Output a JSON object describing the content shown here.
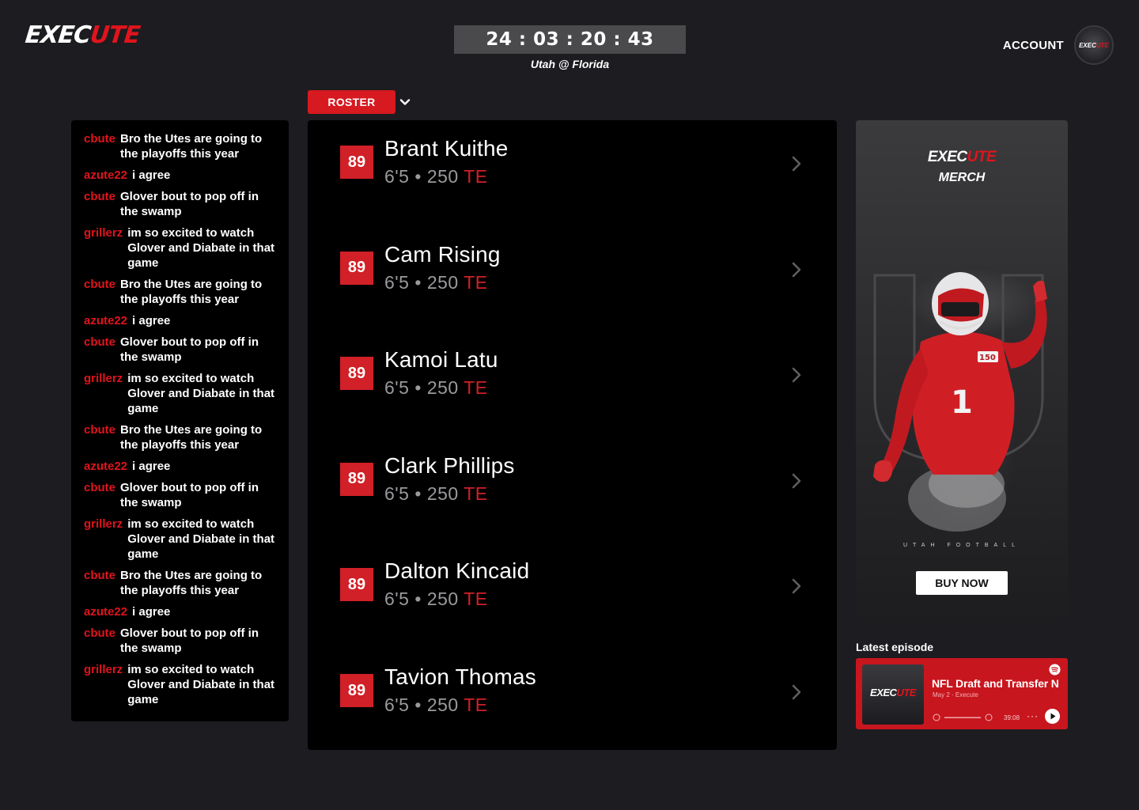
{
  "brand": {
    "logo_white": "EXEC",
    "logo_red": "UTE",
    "accent": "#e0141c"
  },
  "header": {
    "countdown": "24 : 03 : 20 : 43",
    "matchup": "Utah @ Florida",
    "account_label": "ACCOUNT",
    "avatar_logo_white": "EXEC",
    "avatar_logo_red": "UTE"
  },
  "roster_dropdown": {
    "label": "ROSTER"
  },
  "chat": {
    "messages": [
      {
        "user": "cbute",
        "text": "Bro the Utes are going to the playoffs this year"
      },
      {
        "user": "azute22",
        "text": "i agree"
      },
      {
        "user": "cbute",
        "text": "Glover bout to pop off in the swamp"
      },
      {
        "user": "grillerz",
        "text": "im so excited to watch Glover and Diabate in that game"
      },
      {
        "user": "cbute",
        "text": "Bro the Utes are going to the playoffs this year"
      },
      {
        "user": "azute22",
        "text": "i agree"
      },
      {
        "user": "cbute",
        "text": "Glover bout to pop off in the swamp"
      },
      {
        "user": "grillerz",
        "text": "im so excited to watch Glover and Diabate in that game"
      },
      {
        "user": "cbute",
        "text": "Bro the Utes are going to the playoffs this year"
      },
      {
        "user": "azute22",
        "text": "i agree"
      },
      {
        "user": "cbute",
        "text": "Glover bout to pop off in the swamp"
      },
      {
        "user": "grillerz",
        "text": "im so excited to watch Glover and Diabate in that game"
      },
      {
        "user": "cbute",
        "text": "Bro the Utes are going to the playoffs this year"
      },
      {
        "user": "azute22",
        "text": "i agree"
      },
      {
        "user": "cbute",
        "text": "Glover bout to pop off in the swamp"
      },
      {
        "user": "grillerz",
        "text": "im so excited to watch Glover and Diabate in that game"
      }
    ]
  },
  "roster": {
    "players": [
      {
        "number": "89",
        "name": "Brant Kuithe",
        "height": "6'5",
        "sep": "•",
        "weight": "250",
        "position": "TE"
      },
      {
        "number": "89",
        "name": "Cam Rising",
        "height": "6'5",
        "sep": "•",
        "weight": "250",
        "position": "TE"
      },
      {
        "number": "89",
        "name": "Kamoi Latu",
        "height": "6'5",
        "sep": "•",
        "weight": "250",
        "position": "TE"
      },
      {
        "number": "89",
        "name": "Clark Phillips",
        "height": "6'5",
        "sep": "•",
        "weight": "250",
        "position": "TE"
      },
      {
        "number": "89",
        "name": "Dalton Kincaid",
        "height": "6'5",
        "sep": "•",
        "weight": "250",
        "position": "TE"
      },
      {
        "number": "89",
        "name": "Tavion Thomas",
        "height": "6'5",
        "sep": "•",
        "weight": "250",
        "position": "TE"
      }
    ]
  },
  "merch": {
    "logo_white": "EXEC",
    "logo_red": "UTE",
    "subtitle": "MERCH",
    "tagline": "UTAH FOOTBALL",
    "jersey_number": "1",
    "patch_number": "150",
    "buy_label": "BUY NOW"
  },
  "episode": {
    "section_label": "Latest episode",
    "title": "NFL Draft and Transfer N",
    "meta": "May 2 · Execute",
    "duration": "39:08",
    "thumb_logo_white": "EXEC",
    "thumb_logo_red": "UTE"
  }
}
